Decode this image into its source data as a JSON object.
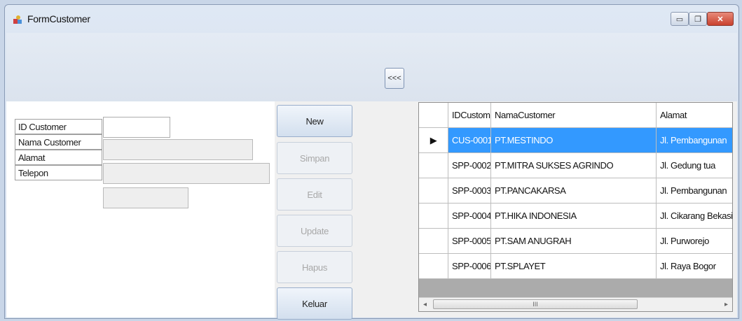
{
  "window": {
    "title": "FormCustomer",
    "min_glyph": "▭",
    "max_glyph": "❐",
    "close_glyph": "✕"
  },
  "toolbar": {
    "collapse_label": "<<<"
  },
  "form": {
    "labels": {
      "id": "ID Customer",
      "nama": "Nama Customer",
      "alamat": "Alamat",
      "telepon": "Telepon"
    },
    "values": {
      "id": "",
      "nama": "",
      "alamat": "",
      "telepon": ""
    }
  },
  "buttons": {
    "new": "New",
    "simpan": "Simpan",
    "edit": "Edit",
    "update": "Update",
    "hapus": "Hapus",
    "keluar": "Keluar"
  },
  "grid": {
    "headers": [
      "IDCustomer",
      "NamaCustomer",
      "Alamat"
    ],
    "rows": [
      [
        "CUS-0001",
        "PT.MESTINDO",
        "Jl. Pembangunan"
      ],
      [
        "SPP-0002",
        "PT.MITRA SUKSES AGRINDO",
        "Jl. Gedung tua"
      ],
      [
        "SPP-0003",
        "PT.PANCAKARSA",
        "Jl. Pembangunan"
      ],
      [
        "SPP-0004",
        "PT.HIKA INDONESIA",
        "Jl. Cikarang Bekasi"
      ],
      [
        "SPP-0005",
        "PT.SAM ANUGRAH",
        "Jl. Purworejo"
      ],
      [
        "SPP-0006",
        "PT.SPLAYET",
        "Jl. Raya Bogor"
      ]
    ],
    "selected_row": 0,
    "current_row_glyph": "▶",
    "scroll_left": "◂",
    "scroll_right": "▸",
    "thumb_grip": "III"
  },
  "colors": {
    "selection": "#3399ff",
    "titlebar": "#dfe8f4"
  }
}
